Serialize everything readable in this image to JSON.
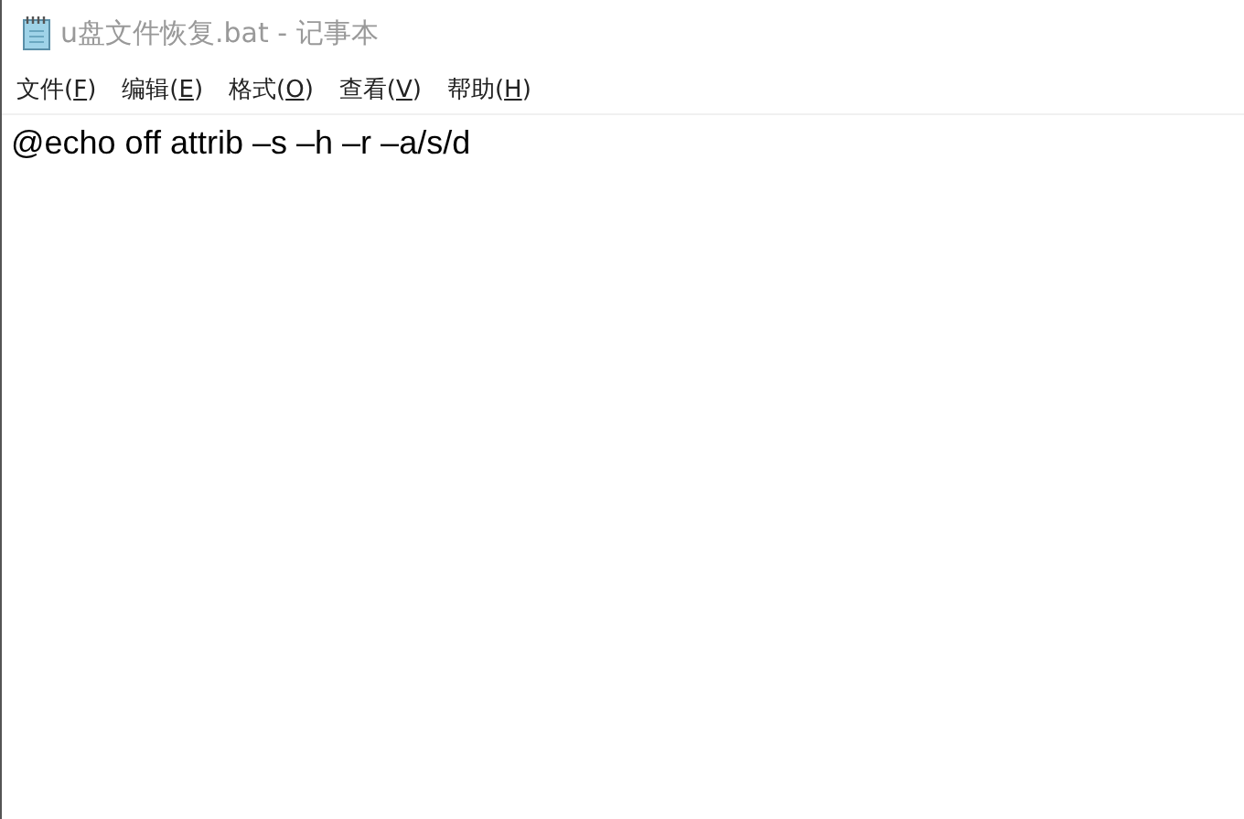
{
  "window": {
    "title": "u盘文件恢复.bat - 记事本"
  },
  "menu": [
    {
      "before": "文件(",
      "key": "F",
      "after": ")"
    },
    {
      "before": "编辑(",
      "key": "E",
      "after": ")"
    },
    {
      "before": "格式(",
      "key": "O",
      "after": ")"
    },
    {
      "before": "查看(",
      "key": "V",
      "after": ")"
    },
    {
      "before": "帮助(",
      "key": "H",
      "after": ")"
    }
  ],
  "editor": {
    "text": "@echo off attrib –s –h –r –a/s/d"
  }
}
